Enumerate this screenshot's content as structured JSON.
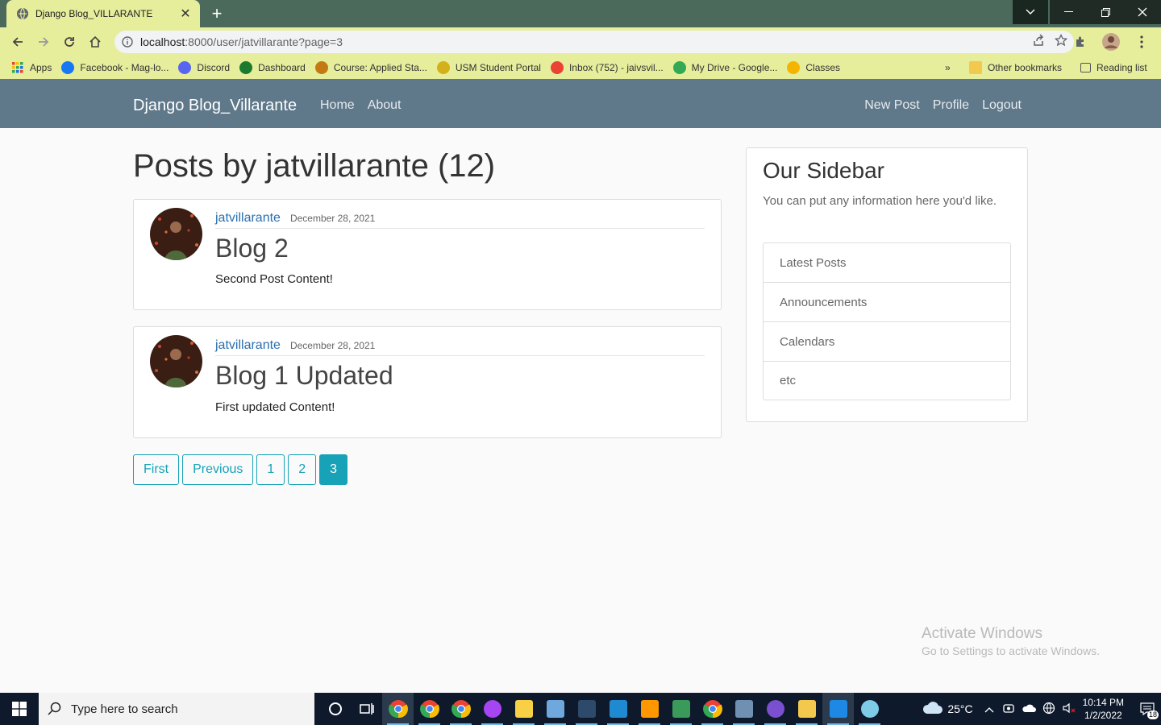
{
  "browser": {
    "tab_title": "Django Blog_VILLARANTE",
    "url_host": "localhost",
    "url_rest": ":8000/user/jatvillarante?page=3",
    "bookmarks": [
      {
        "label": "Apps",
        "icon": "apps-grid-icon",
        "color": "#1a73e8"
      },
      {
        "label": "Facebook - Mag-lo...",
        "icon": "facebook-icon",
        "color": "#1877f2"
      },
      {
        "label": "Discord",
        "icon": "discord-icon",
        "color": "#5865f2"
      },
      {
        "label": "Dashboard",
        "icon": "usm-icon",
        "color": "#1b7a2e"
      },
      {
        "label": "Course: Applied Sta...",
        "icon": "moodle-icon",
        "color": "#c47a12"
      },
      {
        "label": "USM Student Portal",
        "icon": "usm-portal-icon",
        "color": "#d4b01a"
      },
      {
        "label": "Inbox (752) - jaivsvil...",
        "icon": "gmail-icon",
        "color": "#ea4335"
      },
      {
        "label": "My Drive - Google...",
        "icon": "drive-icon",
        "color": "#34a853"
      },
      {
        "label": "Classes",
        "icon": "classroom-icon",
        "color": "#f4b400"
      }
    ],
    "other_bookmarks": "Other bookmarks",
    "reading_list": "Reading list"
  },
  "site": {
    "brand": "Django Blog_Villarante",
    "nav_left": [
      "Home",
      "About"
    ],
    "nav_right": [
      "New Post",
      "Profile",
      "Logout"
    ]
  },
  "main": {
    "heading": "Posts by jatvillarante (12)",
    "posts": [
      {
        "author": "jatvillarante",
        "date": "December 28, 2021",
        "title": "Blog 2",
        "content": "Second Post Content!"
      },
      {
        "author": "jatvillarante",
        "date": "December 28, 2021",
        "title": "Blog 1 Updated",
        "content": "First updated Content!"
      }
    ],
    "pagination": {
      "first": "First",
      "previous": "Previous",
      "pages": [
        "1",
        "2",
        "3"
      ],
      "current": "3"
    }
  },
  "sidebar": {
    "title": "Our Sidebar",
    "text": "You can put any information here you'd like.",
    "items": [
      "Latest Posts",
      "Announcements",
      "Calendars",
      "etc"
    ]
  },
  "watermark": {
    "line1": "Activate Windows",
    "line2": "Go to Settings to activate Windows."
  },
  "taskbar": {
    "search_placeholder": "Type here to search",
    "weather": "25°C",
    "time": "10:14 PM",
    "date": "1/2/2022",
    "notification_count": "18"
  }
}
